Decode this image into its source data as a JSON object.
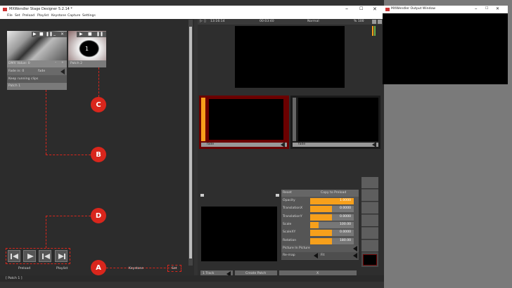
{
  "window": {
    "title": "MXWendler Stage Designer 5.2.14 *"
  },
  "menu": [
    "File",
    "Set",
    "Preload",
    "Playlist",
    "Keystone",
    "Capture",
    "Settings"
  ],
  "patch1": {
    "label": "DMX Value: 0",
    "fade_label": "Fade in: 0",
    "fade_mode": "fade",
    "keep_label": "Keep running clips",
    "name": "Patch 1"
  },
  "patch2": {
    "label": "Patch 2",
    "number": "1"
  },
  "callouts": [
    "A",
    "B",
    "C",
    "D"
  ],
  "bottom_tabs": [
    "Preload",
    "Playlist",
    "Keystone",
    "Set"
  ],
  "status": "[ Patch 1 ]",
  "preview": {
    "time_current": "13:16:14",
    "time_total": "00:03:40",
    "mode": "Normal",
    "zoom": "% 100"
  },
  "layers": [
    {
      "mode": "fade"
    },
    {
      "mode": "fade"
    }
  ],
  "props": {
    "reset": "Reset",
    "copy_preload": "Copy to Preload",
    "rows": [
      {
        "label": "Opacity",
        "value": "1.0000",
        "fill": 1.0
      },
      {
        "label": "TranslationX",
        "value": "0.0000",
        "fill": 0.5
      },
      {
        "label": "TranslationY",
        "value": "0.0000",
        "fill": 0.5
      },
      {
        "label": "Scale",
        "value": "100.00",
        "fill": 0.2
      },
      {
        "label": "ScaleXY",
        "value": "0.0000",
        "fill": 0.5
      },
      {
        "label": "Rotation",
        "value": "180.00",
        "fill": 0.5
      }
    ],
    "pip": "Picture In Picture",
    "remap": "Re-map",
    "fit": "Fit"
  },
  "bottom_right": {
    "track": "1 Track",
    "create_patch": "Create Patch",
    "x": "X"
  },
  "output_window": {
    "title": "MXWendler Output Window"
  },
  "colors": {
    "accent": "#f7a01b",
    "callout": "#d9261c",
    "layer_active": "#6b0000"
  }
}
